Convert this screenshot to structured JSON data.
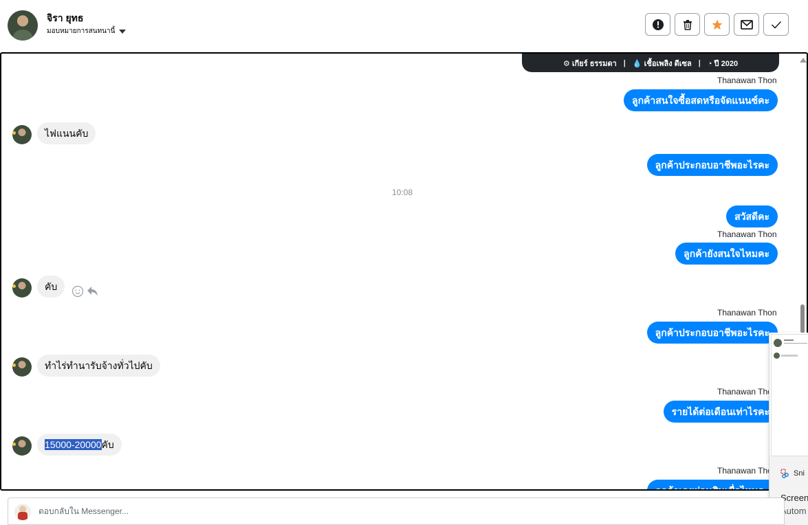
{
  "header": {
    "name": "จิรา ยุทธ",
    "assign_label": "มอบหมายการสนทนานี้",
    "actions": [
      "mark-spam",
      "delete",
      "star",
      "mark-unread",
      "done"
    ]
  },
  "card_strip": {
    "gear": "เกียร์ ธรรมดา",
    "fuel": "เชื้อเพลิง ดีเซล",
    "year": "ปี 2020"
  },
  "messages": {
    "m1_sender": "Thanawan Thon",
    "m1_text": "ลูกค้าสนใจซื้อสดหรือจัดแนนซ์คะ",
    "m2_text": "ไฟแนนคับ",
    "m3_text": "ลูกค้าประกอบอาชีพอะไรคะ",
    "time_1": "10:08",
    "m4_text": "สวัสดีคะ",
    "m5_sender": "Thanawan Thon",
    "m5_text": "ลูกค้ายังสนใจไหมคะ",
    "m6_text": "คับ",
    "m7_sender": "Thanawan Thon",
    "m7_text": "ลูกค้าประกอบอาชีพอะไรคะ",
    "m8_text": "ทำไร่ทำนารับจ้างทั่วไปคับ",
    "m9_sender": "Thanawan Thon",
    "m9_text": "รายได้ต่อเดือนเท่าไรคะ",
    "m10_highlight": "15000-20000",
    "m10_rest": "คับ",
    "m11_sender": "Thanawan Thon",
    "m11_text": "ลูกค้าเคยผ่อนสินเชื่อไหมคะ"
  },
  "popup": {
    "app": "Sni",
    "title": "Screen",
    "subtitle": "Autom"
  },
  "reply": {
    "placeholder": "ตอบกลับใน Messenger..."
  }
}
